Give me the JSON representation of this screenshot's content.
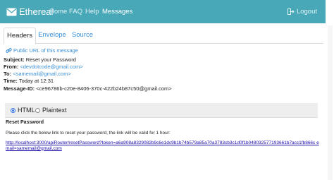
{
  "navbar": {
    "brand": "Ethereal",
    "links": [
      "Home",
      "FAQ",
      "Help",
      "Messages"
    ],
    "active": "Messages",
    "logout": "Logout"
  },
  "tabs": [
    "Headers",
    "Envelope",
    "Source"
  ],
  "active_tab": "Headers",
  "public_url": "Public URL of this message",
  "headers": {
    "subject_label": "Subject:",
    "subject": "Reset your Password",
    "from_label": "From:",
    "from": "<devdotcode@gmail.com>",
    "to_label": "To:",
    "to": "<samemail@gmail.com>",
    "time_label": "Time:",
    "time": "Today at 12:31",
    "message_id_label": "Message-ID:",
    "message_id": "<ce96786b-c20e-8406-370c-422b24b87c50@gmail.com>"
  },
  "view": {
    "html_label": "HTML",
    "plaintext_label": "Plaintext",
    "selected": "HTML"
  },
  "body": {
    "title": "Reset Password",
    "text": "Please click the below link to reset your password, the link will be valid for 1 hour:",
    "link": "http://localhost:3000/apiRouter/resetPassword?token=a6a908a8329082b9c6e1dc9b1b74b579a85a70a3783cb3c1d0f1b048032577193661b7acc1fb866c email=samemail@gmail.com"
  },
  "colors": {
    "navbar": "#48a8b8",
    "link": "#3a8fd6",
    "radio_selected": "#2f6fdd"
  }
}
